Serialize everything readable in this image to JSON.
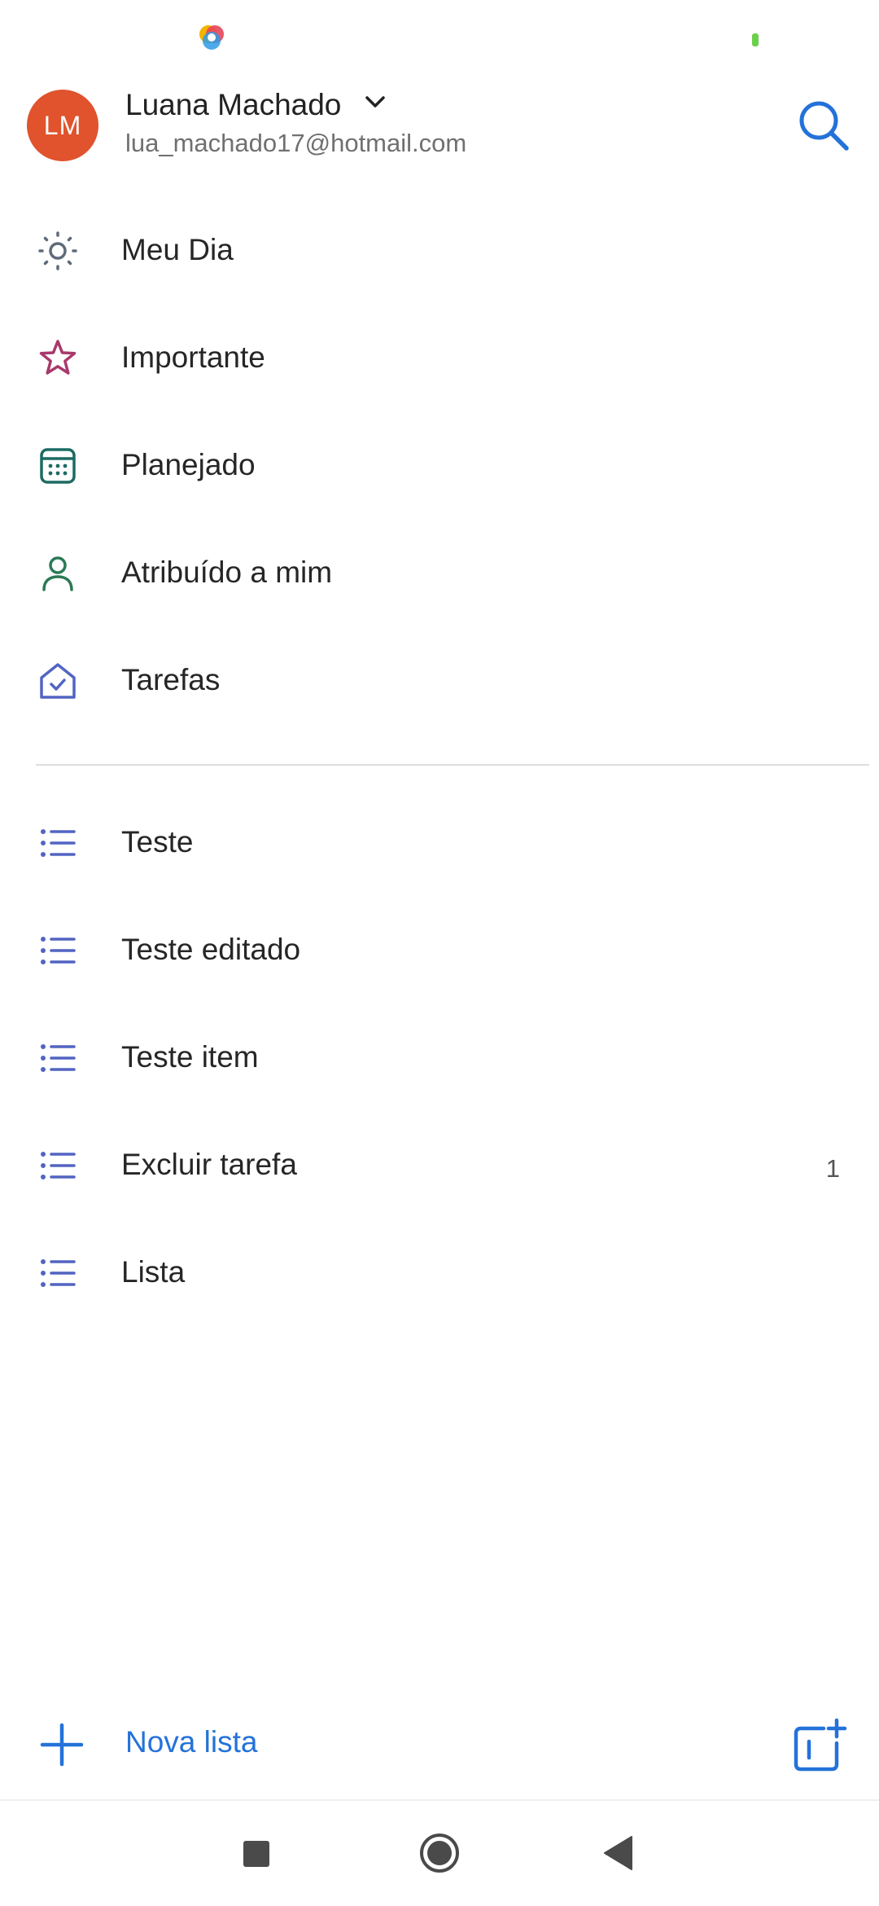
{
  "account": {
    "initials": "LM",
    "name": "Luana Machado",
    "email": "lua_machado17@hotmail.com"
  },
  "smart_lists": [
    {
      "label": "Meu Dia",
      "icon": "sun-icon",
      "color": "#5f6b7a"
    },
    {
      "label": "Importante",
      "icon": "star-icon",
      "color": "#a8396b"
    },
    {
      "label": "Planejado",
      "icon": "calendar-icon",
      "color": "#1b6b63"
    },
    {
      "label": "Atribuído a mim",
      "icon": "person-icon",
      "color": "#2a7a55"
    },
    {
      "label": "Tarefas",
      "icon": "home-icon",
      "color": "#5264c2"
    }
  ],
  "user_lists": [
    {
      "label": "Teste",
      "count": ""
    },
    {
      "label": "Teste editado",
      "count": ""
    },
    {
      "label": "Teste item",
      "count": ""
    },
    {
      "label": "Excluir tarefa",
      "count": "1"
    },
    {
      "label": "Lista",
      "count": ""
    }
  ],
  "footer": {
    "new_list_label": "Nova lista"
  },
  "colors": {
    "accent": "#2472d9",
    "avatar": "#e0532d",
    "list_icon": "#5264c2"
  }
}
